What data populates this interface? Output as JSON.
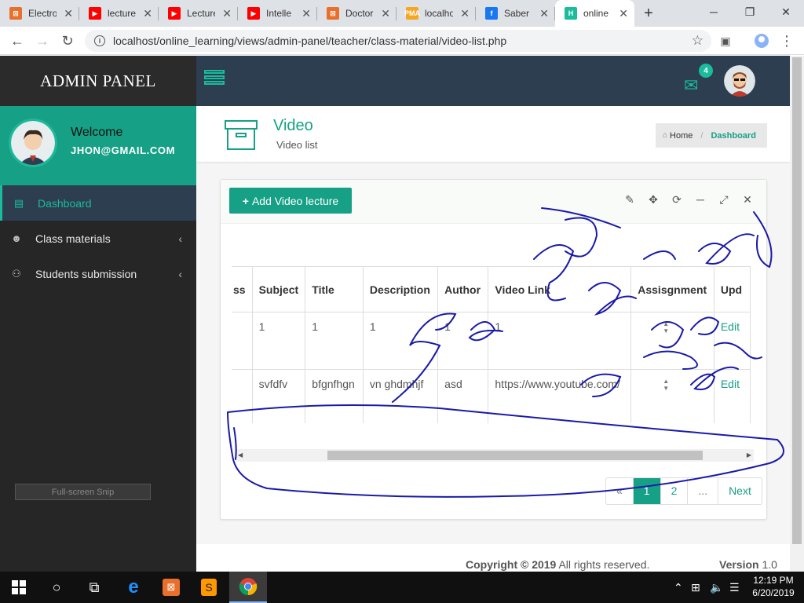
{
  "browser": {
    "tabs": [
      {
        "label": "Electro",
        "favicon_color": "#e8702a",
        "favicon": "⊠"
      },
      {
        "label": "lecture",
        "favicon_color": "#ff0000",
        "favicon": "▶"
      },
      {
        "label": "Lecture",
        "favicon_color": "#ff0000",
        "favicon": "▶"
      },
      {
        "label": "Intelle",
        "favicon_color": "#ff0000",
        "favicon": "▶"
      },
      {
        "label": "Doctor",
        "favicon_color": "#e8702a",
        "favicon": "⊠"
      },
      {
        "label": "localho",
        "favicon_color": "#f5a623",
        "favicon": "PMA"
      },
      {
        "label": "Saber",
        "favicon_color": "#1877f2",
        "favicon": "f"
      },
      {
        "label": "online",
        "favicon_color": "#1abc9c",
        "favicon": "H",
        "active": true
      }
    ],
    "url": "localhost/online_learning/views/admin-panel/teacher/class-material/video-list.php"
  },
  "app": {
    "logo": "ADMIN PANEL",
    "mail_count": "4",
    "profile": {
      "welcome": "Welcome",
      "email": "JHON@GMAIL.COM"
    },
    "nav": [
      {
        "label": "Dashboard",
        "icon": "clipboard-icon",
        "active": true
      },
      {
        "label": "Class materials",
        "icon": "user-icon"
      },
      {
        "label": "Students submission",
        "icon": "sitemap-icon"
      }
    ],
    "snip_label": "Full-screen Snip",
    "page": {
      "title": "Video",
      "subtitle": "Video list"
    },
    "breadcrumb": {
      "home": "Home",
      "current": "Dashboard"
    },
    "add_button": "Add Video lecture",
    "table": {
      "columns": [
        "ss",
        "Subject",
        "Title",
        "Description",
        "Author",
        "Video Link",
        "Assisgnment",
        "Upd"
      ],
      "rows": [
        [
          "",
          "1",
          "1",
          "1",
          "1",
          "1",
          "",
          "Edit"
        ],
        [
          "",
          "svfdfv",
          "bfgnfhgn",
          "vn ghdmhjf",
          "asd",
          "https://www.youtube.com/",
          "",
          "Edit"
        ]
      ]
    },
    "pagination": [
      "«",
      "1",
      "2",
      "...",
      "Next"
    ],
    "footer": {
      "copyright_bold": "Copyright © 2019",
      "copyright_rest": " All rights reserved.",
      "version_label": "Version",
      "version": "1.0"
    }
  },
  "taskbar": {
    "time": "12:19 PM",
    "date": "6/20/2019"
  }
}
